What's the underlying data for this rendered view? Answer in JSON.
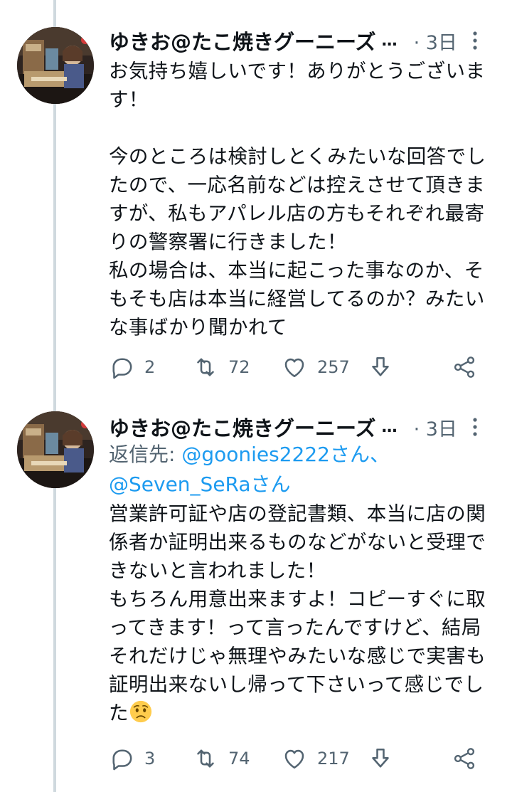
{
  "tweets": [
    {
      "display_name": "ゆきお@たこ焼きグーニーズ",
      "ellipsis": "…",
      "time": "· 3日",
      "text": "お気持ち嬉しいです！ありがとうございます！\n\n今のところは検討しとくみたいな回答でしたので、一応名前などは控えさせて頂きますが、私もアパレル店の方もそれぞれ最寄りの警察署に行きました！\n私の場合は、本当に起こった事なのか、そもそも店は本当に経営してるのか？みたいな事ばかり聞かれて",
      "counts": {
        "replies": "2",
        "retweets": "72",
        "likes": "257"
      }
    },
    {
      "display_name": "ゆきお@たこ焼きグーニーズ",
      "ellipsis": "…",
      "time": "· 3日",
      "reply_prefix": "返信先: ",
      "reply_mention_1": "@goonies2222さん",
      "reply_sep": "、",
      "reply_mention_2": "@Seven_SeRaさん",
      "text": "営業許可証や店の登記書類、本当に店の関係者か証明出来るものなどがないと受理できないと言われました！\nもちろん用意出来ますよ！コピーすぐに取ってきます！って言ったんですけど、結局それだけじゃ無理やみたいな感じで実害も証明出来ないし帰って下さいって感じでした",
      "emoji": "worried-face",
      "counts": {
        "replies": "3",
        "retweets": "74",
        "likes": "217"
      }
    }
  ],
  "colors": {
    "text": "#0f1419",
    "secondary": "#536471",
    "link": "#1d9bf0",
    "thread_line": "#cfd9de"
  }
}
